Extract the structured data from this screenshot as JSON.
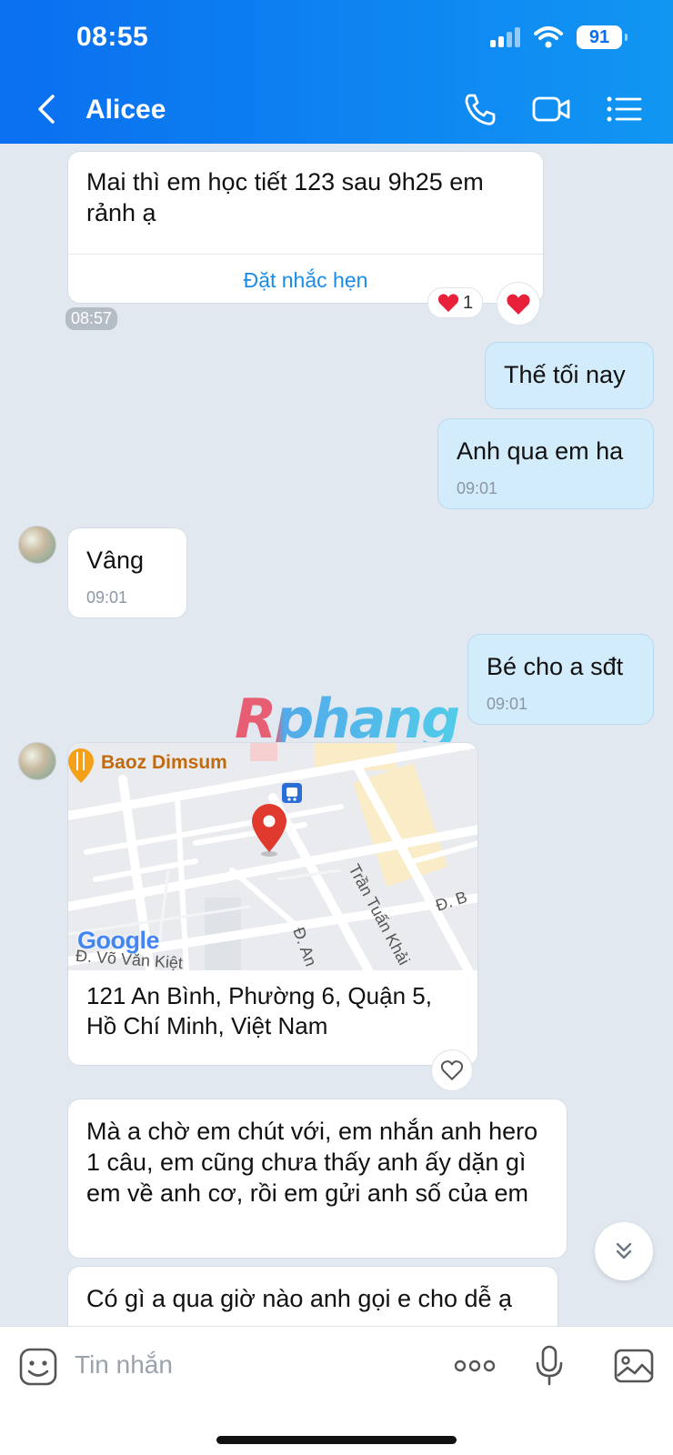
{
  "status_bar": {
    "time": "08:55",
    "battery": "91"
  },
  "nav": {
    "contact_name": "Alicee"
  },
  "messages": {
    "m1": {
      "text": "Mai thì em học tiết 123 sau 9h25 em rảnh ạ",
      "action": "Đặt nhắc hẹn",
      "time": "08:57",
      "reaction_count": "1"
    },
    "m2": {
      "text": "Thế tối nay"
    },
    "m3": {
      "text": "Anh qua em ha",
      "time": "09:01"
    },
    "m4": {
      "text": "Vâng",
      "time": "09:01"
    },
    "m5": {
      "text": "Bé cho a sđt",
      "time": "09:01"
    },
    "m6": {
      "place_label": "Baoz Dimsum",
      "street_1": "Trần Tuấn Khải",
      "street_2": "Đ. B",
      "street_3": "Đ. An",
      "street_4": "Đ. Võ Văn Kiệt",
      "map_brand": "Google",
      "address": "121 An Bình, Phường 6, Quận 5, Hồ Chí Minh, Việt Nam"
    },
    "m7": {
      "text": "Mà a chờ em chút với, em nhắn anh hero 1 câu, em cũng chưa thấy anh ấy dặn gì em về anh cơ, rồi em gửi anh số của em"
    },
    "m8": {
      "text": "Có gì a qua giờ nào anh gọi e cho dễ ạ"
    }
  },
  "watermark": "Rphang",
  "composer": {
    "placeholder": "Tin nhắn"
  },
  "colors": {
    "header": "#0a6ff0",
    "my_bubble": "#d3ecfb",
    "background": "#e2e8f0",
    "link": "#1a8ce8"
  }
}
